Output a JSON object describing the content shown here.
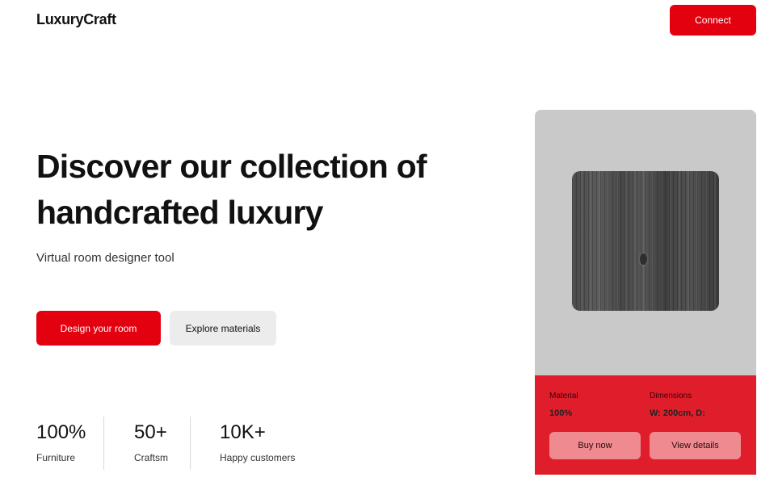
{
  "header": {
    "logo": "LuxuryCraft",
    "connect_label": "Connect"
  },
  "hero": {
    "title": "Discover our collection of handcrafted luxury",
    "subtitle": "Virtual room designer tool",
    "primary_cta": "Design your room",
    "secondary_cta": "Explore materials"
  },
  "stats": [
    {
      "value": "100%",
      "label": "Furniture"
    },
    {
      "value": "50+",
      "label": "Craftsm"
    },
    {
      "value": "10K+",
      "label": "Happy customers"
    }
  ],
  "product_card": {
    "material_label": "Material",
    "material_value": "100%",
    "dimensions_label": "Dimensions",
    "dimensions_value": "W: 200cm, D:",
    "buy_label": "Buy now",
    "details_label": "View details"
  },
  "colors": {
    "accent": "#e3000f",
    "card_info_bg": "#e01d2b",
    "card_image_bg": "#c9c9c9",
    "secondary_button_bg": "#ececec"
  },
  "icons": {
    "product_image": "wood-texture"
  }
}
